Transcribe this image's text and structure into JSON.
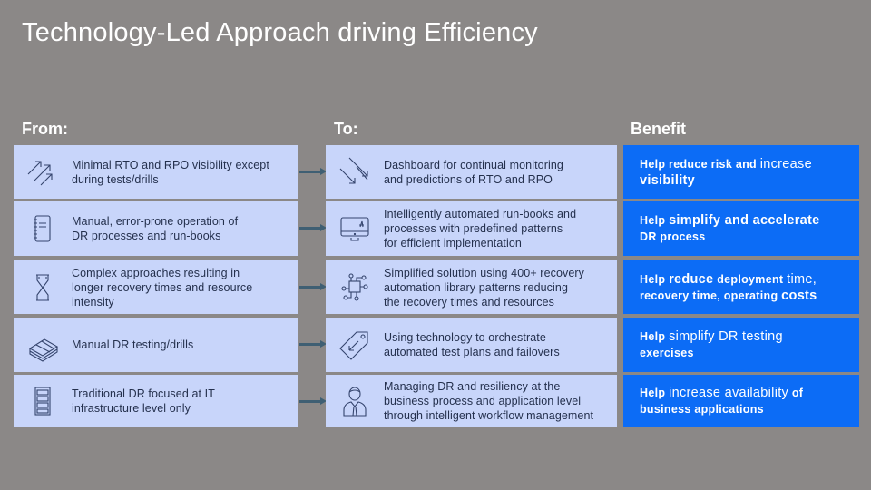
{
  "title": "Technology-Led Approach driving Efficiency",
  "headers": {
    "from": "From:",
    "to": "To:",
    "benefit": "Benefit"
  },
  "rows": [
    {
      "from": {
        "icon": "trend-up-arrows-icon",
        "text": "Minimal RTO and RPO visibility except\nduring tests/drills"
      },
      "to": {
        "icon": "trend-down-arrows-icon",
        "text": "Dashboard for continual monitoring\nand predictions of RTO and RPO"
      },
      "benefit": {
        "parts": [
          {
            "t": "Help reduce risk and ",
            "s": "small"
          },
          {
            "t": "increase",
            "s": "big"
          },
          {
            "t": "\n",
            "s": "small"
          },
          {
            "t": "visibility",
            "s": "bigb"
          }
        ]
      }
    },
    {
      "from": {
        "icon": "notebook-icon",
        "text": "Manual, error-prone  operation of\nDR processes and run-books"
      },
      "to": {
        "icon": "monitor-icon",
        "text": "Intelligently automated run-books and\nprocesses with predefined patterns\nfor efficient implementation"
      },
      "benefit": {
        "parts": [
          {
            "t": "Help  ",
            "s": "small"
          },
          {
            "t": "simplify and accelerate",
            "s": "bigb"
          },
          {
            "t": "\n",
            "s": "small"
          },
          {
            "t": "DR process",
            "s": "small"
          }
        ]
      }
    },
    {
      "from": {
        "icon": "hourglass-icon",
        "text": "Complex approaches resulting in\nlonger recovery times and resource\nintensity"
      },
      "to": {
        "icon": "network-nodes-icon",
        "text": "Simplified solution using 400+ recovery\nautomation library patterns reducing\nthe recovery times and resources"
      },
      "benefit": {
        "parts": [
          {
            "t": "Help ",
            "s": "small"
          },
          {
            "t": "reduce",
            "s": "bigb"
          },
          {
            "t": " deployment ",
            "s": "small"
          },
          {
            "t": "time,",
            "s": "big"
          },
          {
            "t": "\n",
            "s": "small"
          },
          {
            "t": "recovery time, operating ",
            "s": "small"
          },
          {
            "t": "costs",
            "s": "bigb"
          }
        ]
      }
    },
    {
      "from": {
        "icon": "paper-stack-icon",
        "text": "Manual DR testing/drills"
      },
      "to": {
        "icon": "tag-icon",
        "text": "Using technology to orchestrate\nautomated test plans and failovers"
      },
      "benefit": {
        "parts": [
          {
            "t": "Help ",
            "s": "small"
          },
          {
            "t": "simplify DR testing",
            "s": "big"
          },
          {
            "t": "\n",
            "s": "small"
          },
          {
            "t": "exercises",
            "s": "small"
          }
        ]
      }
    },
    {
      "from": {
        "icon": "server-rack-icon",
        "text": "Traditional DR focused at IT\ninfrastructure level only"
      },
      "to": {
        "icon": "business-person-icon",
        "text": "Managing DR and resiliency at the\nbusiness process and application level\nthrough intelligent workflow management"
      },
      "benefit": {
        "parts": [
          {
            "t": "Help  ",
            "s": "small"
          },
          {
            "t": "increase availability",
            "s": "big"
          },
          {
            "t": " of",
            "s": "small"
          },
          {
            "t": "\n",
            "s": "small"
          },
          {
            "t": "business applications",
            "s": "small"
          }
        ]
      }
    }
  ]
}
